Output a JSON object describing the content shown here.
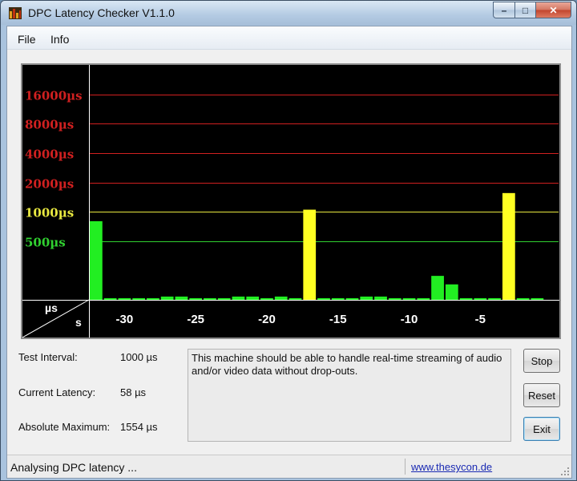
{
  "window": {
    "title": "DPC Latency Checker V1.1.0",
    "controls": {
      "minimize": "–",
      "maximize": "□",
      "close": "✕"
    }
  },
  "menu": {
    "items": [
      {
        "label": "File"
      },
      {
        "label": "Info"
      }
    ]
  },
  "chart_data": {
    "type": "bar",
    "title": "",
    "y_axis_label": "µs",
    "x_axis_label": "s",
    "y_scale": "log2",
    "y_ticks": [
      {
        "label": "16000µs",
        "value": 16000,
        "color": "#d02020"
      },
      {
        "label": "8000µs",
        "value": 8000,
        "color": "#d02020"
      },
      {
        "label": "4000µs",
        "value": 4000,
        "color": "#d02020"
      },
      {
        "label": "2000µs",
        "value": 2000,
        "color": "#d02020"
      },
      {
        "label": "1000µs",
        "value": 1000,
        "color": "#e8e840"
      },
      {
        "label": "500µs",
        "value": 500,
        "color": "#30d030"
      }
    ],
    "x_ticks": [
      {
        "label": "-30",
        "value": -30
      },
      {
        "label": "-25",
        "value": -25
      },
      {
        "label": "-20",
        "value": -20
      },
      {
        "label": "-15",
        "value": -15
      },
      {
        "label": "-10",
        "value": -10
      },
      {
        "label": "-5",
        "value": -5
      }
    ],
    "x_range": [
      -32.5,
      0.5
    ],
    "y_range": [
      125,
      32000
    ],
    "grid": true,
    "threshold_colors": {
      "green": "#22ee22",
      "yellow": "#ffff22"
    },
    "bars": [
      {
        "x": -32,
        "value": 800,
        "color": "green"
      },
      {
        "x": -31,
        "value": 130,
        "color": "green"
      },
      {
        "x": -30,
        "value": 130,
        "color": "green"
      },
      {
        "x": -29,
        "value": 130,
        "color": "green"
      },
      {
        "x": -28,
        "value": 130,
        "color": "green"
      },
      {
        "x": -27,
        "value": 135,
        "color": "green"
      },
      {
        "x": -26,
        "value": 135,
        "color": "green"
      },
      {
        "x": -25,
        "value": 130,
        "color": "green"
      },
      {
        "x": -24,
        "value": 130,
        "color": "green"
      },
      {
        "x": -23,
        "value": 130,
        "color": "green"
      },
      {
        "x": -22,
        "value": 135,
        "color": "green"
      },
      {
        "x": -21,
        "value": 135,
        "color": "green"
      },
      {
        "x": -20,
        "value": 130,
        "color": "green"
      },
      {
        "x": -19,
        "value": 135,
        "color": "green"
      },
      {
        "x": -18,
        "value": 130,
        "color": "green"
      },
      {
        "x": -17,
        "value": 1050,
        "color": "yellow"
      },
      {
        "x": -16,
        "value": 130,
        "color": "green"
      },
      {
        "x": -15,
        "value": 130,
        "color": "green"
      },
      {
        "x": -14,
        "value": 130,
        "color": "green"
      },
      {
        "x": -13,
        "value": 135,
        "color": "green"
      },
      {
        "x": -12,
        "value": 135,
        "color": "green"
      },
      {
        "x": -11,
        "value": 130,
        "color": "green"
      },
      {
        "x": -10,
        "value": 130,
        "color": "green"
      },
      {
        "x": -9,
        "value": 130,
        "color": "green"
      },
      {
        "x": -8,
        "value": 220,
        "color": "green"
      },
      {
        "x": -7,
        "value": 180,
        "color": "green"
      },
      {
        "x": -6,
        "value": 130,
        "color": "green"
      },
      {
        "x": -5,
        "value": 130,
        "color": "green"
      },
      {
        "x": -4,
        "value": 130,
        "color": "green"
      },
      {
        "x": -3,
        "value": 1554,
        "color": "yellow"
      },
      {
        "x": -2,
        "value": 130,
        "color": "green"
      },
      {
        "x": -1,
        "value": 130,
        "color": "green"
      }
    ]
  },
  "info": {
    "test_interval_label": "Test Interval:",
    "test_interval_value": "1000 µs",
    "current_latency_label": "Current Latency:",
    "current_latency_value": "58 µs",
    "absolute_maximum_label": "Absolute Maximum:",
    "absolute_maximum_value": "1554 µs",
    "message": "This machine should be able to handle real-time streaming of audio and/or video data without drop-outs."
  },
  "buttons": {
    "stop": "Stop",
    "reset": "Reset",
    "exit": "Exit"
  },
  "status": {
    "text": "Analysing DPC latency ...",
    "link": "www.thesycon.de"
  }
}
